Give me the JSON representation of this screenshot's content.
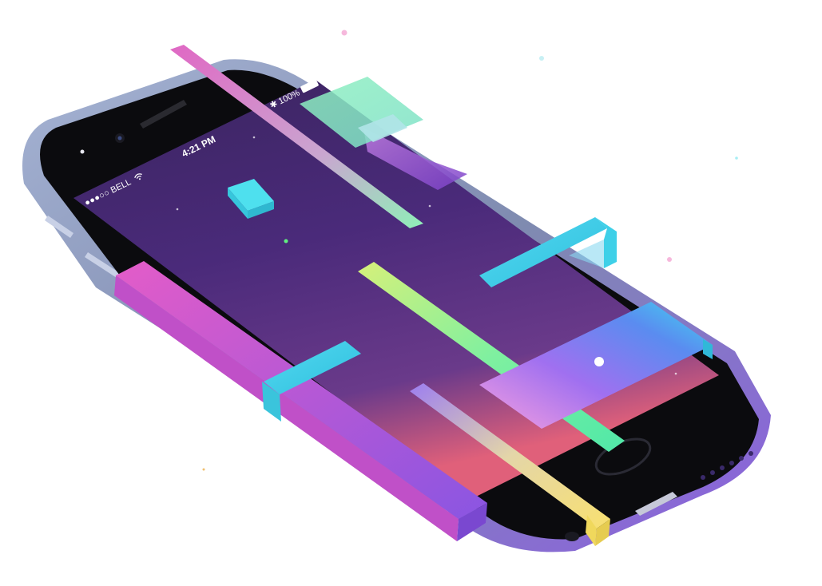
{
  "status_bar": {
    "carrier": "●●●○○ BELL",
    "time": "4:21 PM",
    "battery_percent": "100%"
  },
  "colors": {
    "screen_top": "#4a2a7a",
    "screen_bottom": "#e0607a",
    "phone_body": "#0a0a0c",
    "phone_frame_left": "#9aa6c8",
    "phone_frame_right": "#8a6ed6",
    "pink": "#e05cc6",
    "purple": "#8e5be0",
    "cyan": "#3ed6e6",
    "green": "#6ff0a0",
    "yellow": "#f6e37a"
  },
  "icons": [
    "wifi-icon",
    "bluetooth-icon",
    "battery-icon",
    "home-button"
  ]
}
